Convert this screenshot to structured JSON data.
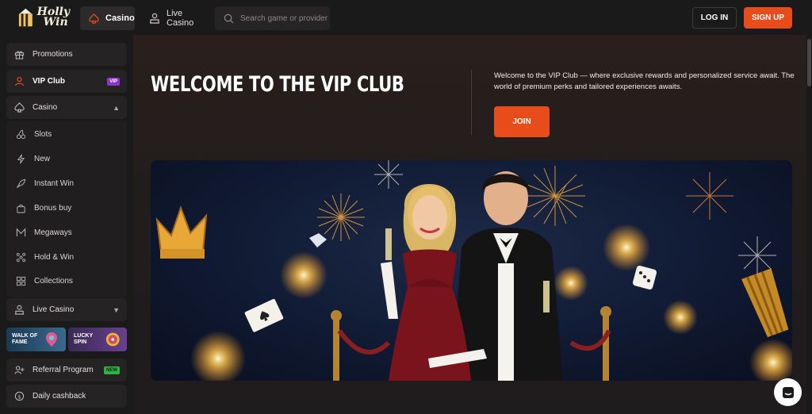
{
  "header": {
    "logo_line1": "Holly",
    "logo_line2": "Win",
    "nav_casino": "Casino",
    "nav_live_casino": "Live Casino",
    "search_placeholder": "Search game or provider",
    "login_label": "LOG IN",
    "signup_label": "SIGN UP"
  },
  "sidebar": {
    "promotions": "Promotions",
    "vip_club": "VIP Club",
    "vip_badge": "VIP",
    "casino": "Casino",
    "casino_items": [
      "Slots",
      "New",
      "Instant Win",
      "Bonus buy",
      "Megaways",
      "Hold & Win",
      "Collections"
    ],
    "live_casino": "Live Casino",
    "walk_of_fame": "WALK OF FAME",
    "lucky_spin": "LUCKY SPIN",
    "referral": "Referral Program",
    "new_badge": "NEW",
    "daily_cashback": "Daily cashback"
  },
  "main": {
    "title": "WELCOME TO THE VIP CLUB",
    "description": "Welcome to the VIP Club — where exclusive rewards and personalized service await. The world of premium perks and tailored experiences awaits.",
    "join_label": "JOIN"
  },
  "colors": {
    "accent": "#e84c1a",
    "vip_badge": "#8f34c9",
    "new_badge": "#2fb443"
  }
}
